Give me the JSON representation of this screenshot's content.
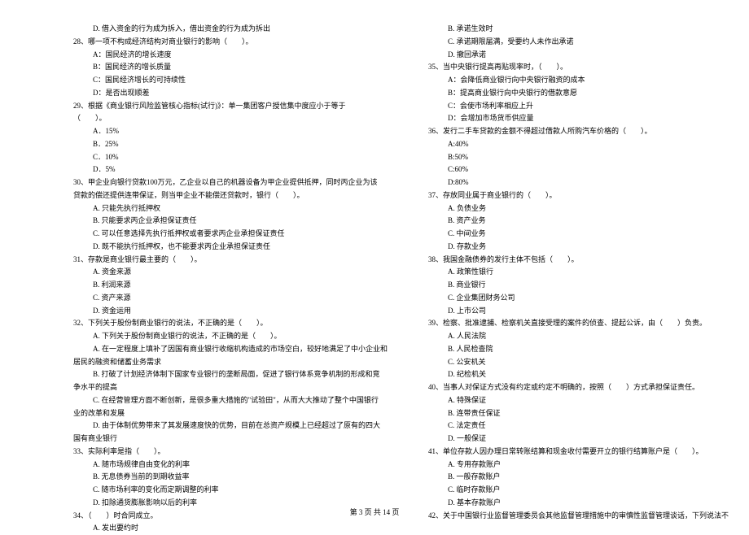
{
  "left": [
    {
      "cls": "indent-1",
      "text": "D. 借入资金的行为成为拆入，借出资金的行为成为拆出"
    },
    {
      "cls": "",
      "text": "28、哪一项不构成经济结构对商业银行的影响（　　）。"
    },
    {
      "cls": "indent-1",
      "text": "A：国民经济的增长速度"
    },
    {
      "cls": "indent-1",
      "text": "B：国民经济的增长质量"
    },
    {
      "cls": "indent-1",
      "text": "C：国民经济增长的可持续性"
    },
    {
      "cls": "indent-1",
      "text": "D：是否出现顺差"
    },
    {
      "cls": "",
      "text": "29、根据《商业银行风险监管核心指标(试行)》：单一集团客户授信集中度应小于等于"
    },
    {
      "cls": "",
      "text": "（　　）。"
    },
    {
      "cls": "indent-1",
      "text": "A．15%"
    },
    {
      "cls": "indent-1",
      "text": "B．25%"
    },
    {
      "cls": "indent-1",
      "text": "C．10%"
    },
    {
      "cls": "indent-1",
      "text": "D．5%"
    },
    {
      "cls": "",
      "text": "30、甲企业向银行贷款100万元，乙企业以自己的机器设备为甲企业提供抵押，同时丙企业为该"
    },
    {
      "cls": "",
      "text": "贷款的偿还提供连带保证，则当甲企业不能偿还贷款时，银行（　　）。"
    },
    {
      "cls": "indent-1",
      "text": "A. 只能先执行抵押权"
    },
    {
      "cls": "indent-1",
      "text": "B. 只能要求丙企业承担保证责任"
    },
    {
      "cls": "indent-1",
      "text": "C. 可以任意选择先执行抵押权或者要求丙企业承担保证责任"
    },
    {
      "cls": "indent-1",
      "text": "D. 既不能执行抵押权，也不能要求丙企业承担保证责任"
    },
    {
      "cls": "",
      "text": "31、存款是商业银行最主要的（　　）。"
    },
    {
      "cls": "indent-1",
      "text": "A. 资金来源"
    },
    {
      "cls": "indent-1",
      "text": "B. 利润来源"
    },
    {
      "cls": "indent-1",
      "text": "C. 资产来源"
    },
    {
      "cls": "indent-1",
      "text": "D. 资金运用"
    },
    {
      "cls": "",
      "text": "32、下列关于股份制商业银行的说法，不正确的是（　　）。"
    },
    {
      "cls": "indent-1",
      "text": "A. 下列关于股份制商业银行的说法，不正确的是（　　）。"
    },
    {
      "cls": "indent-1",
      "text": "A. 在一定程度上填补了因国有商业银行收缩机构造成的市场空白，较好地满足了中小企业和"
    },
    {
      "cls": "",
      "text": "居民的融资和储蓄业务需求"
    },
    {
      "cls": "indent-1",
      "text": "B. 打破了计划经济体制下国家专业银行的垄断局面，促进了银行体系竞争机制的形成和竞"
    },
    {
      "cls": "",
      "text": "争水平的提高"
    },
    {
      "cls": "indent-1",
      "text": "C. 在经营管理方面不断创新，是很多重大措施的\"试验田\"，从而大大推动了整个中国银行"
    },
    {
      "cls": "",
      "text": "业的改革和发展"
    },
    {
      "cls": "indent-1",
      "text": "D. 由于体制优势带来了其发展速度快的优势，目前在总资产规模上已经超过了原有的四大"
    },
    {
      "cls": "",
      "text": "国有商业银行"
    },
    {
      "cls": "",
      "text": "33、实际利率是指（　　）。"
    },
    {
      "cls": "indent-1",
      "text": "A. 随市场规律自由变化的利率"
    },
    {
      "cls": "indent-1",
      "text": "B. 无息债券当前的到期收益率"
    },
    {
      "cls": "indent-1",
      "text": "C. 随市场利率的变化而定期调整的利率"
    },
    {
      "cls": "indent-1",
      "text": "D. 扣除通货膨胀影响以后的利率"
    },
    {
      "cls": "",
      "text": "34、（　　）时合同成立。"
    },
    {
      "cls": "indent-1",
      "text": "A. 发出要约时"
    }
  ],
  "right": [
    {
      "cls": "indent-1",
      "text": "B. 承诺生效时"
    },
    {
      "cls": "indent-1",
      "text": "C. 承诺期限届满，受要约人未作出承诺"
    },
    {
      "cls": "indent-1",
      "text": "D. 撤回承诺"
    },
    {
      "cls": "",
      "text": "35、当中央银行提高再贴现率时，（　　）。"
    },
    {
      "cls": "indent-1",
      "text": "A：会降低商业银行向中央银行融资的成本"
    },
    {
      "cls": "indent-1",
      "text": "B：提高商业银行向中央银行的借款意愿"
    },
    {
      "cls": "indent-1",
      "text": "C：会使市场利率相应上升"
    },
    {
      "cls": "indent-1",
      "text": "D：会增加市场货币供应量"
    },
    {
      "cls": "",
      "text": "36、发行二手车贷款的金额不得超过借款人所购汽车价格的（　　）。"
    },
    {
      "cls": "indent-1",
      "text": "A:40%"
    },
    {
      "cls": "indent-1",
      "text": "B:50%"
    },
    {
      "cls": "indent-1",
      "text": "C:60%"
    },
    {
      "cls": "indent-1",
      "text": "D:80%"
    },
    {
      "cls": "",
      "text": "37、存放同业属于商业银行的（　　）。"
    },
    {
      "cls": "indent-1",
      "text": "A. 负债业务"
    },
    {
      "cls": "indent-1",
      "text": "B. 资产业务"
    },
    {
      "cls": "indent-1",
      "text": "C. 中间业务"
    },
    {
      "cls": "indent-1",
      "text": "D. 存款业务"
    },
    {
      "cls": "",
      "text": "38、我国金融债券的发行主体不包括（　　）。"
    },
    {
      "cls": "indent-1",
      "text": "A. 政策性银行"
    },
    {
      "cls": "indent-1",
      "text": "B. 商业银行"
    },
    {
      "cls": "indent-1",
      "text": "C. 企业集团财务公司"
    },
    {
      "cls": "indent-1",
      "text": "D. 上市公司"
    },
    {
      "cls": "",
      "text": "39、检察、批准逮捕、检察机关直接受理的案件的侦查、提起公诉，由（　　）负责。"
    },
    {
      "cls": "indent-1",
      "text": "A. 人民法院"
    },
    {
      "cls": "indent-1",
      "text": "B. 人民检查院"
    },
    {
      "cls": "indent-1",
      "text": "C. 公安机关"
    },
    {
      "cls": "indent-1",
      "text": "D. 纪检机关"
    },
    {
      "cls": "",
      "text": "40、当事人对保证方式没有约定或约定不明确的，按照（　　）方式承担保证责任。"
    },
    {
      "cls": "indent-1",
      "text": "A. 特殊保证"
    },
    {
      "cls": "indent-1",
      "text": "B. 连带责任保证"
    },
    {
      "cls": "indent-1",
      "text": "C. 法定责任"
    },
    {
      "cls": "indent-1",
      "text": "D. 一般保证"
    },
    {
      "cls": "",
      "text": "41、单位存款人因办理日常转账结算和现金收付需要开立的银行结算账户是（　　）。"
    },
    {
      "cls": "indent-1",
      "text": "A. 专用存款账户"
    },
    {
      "cls": "indent-1",
      "text": "B. 一般存款账户"
    },
    {
      "cls": "indent-1",
      "text": "C. 临时存款账户"
    },
    {
      "cls": "indent-1",
      "text": "D. 基本存款账户"
    },
    {
      "cls": "",
      "text": "42、关于中国银行业监督管理委员会其他监督管理措施中的审慎性监督管理谈话，下列说法不"
    }
  ],
  "pager": "第 3 页 共 14 页"
}
